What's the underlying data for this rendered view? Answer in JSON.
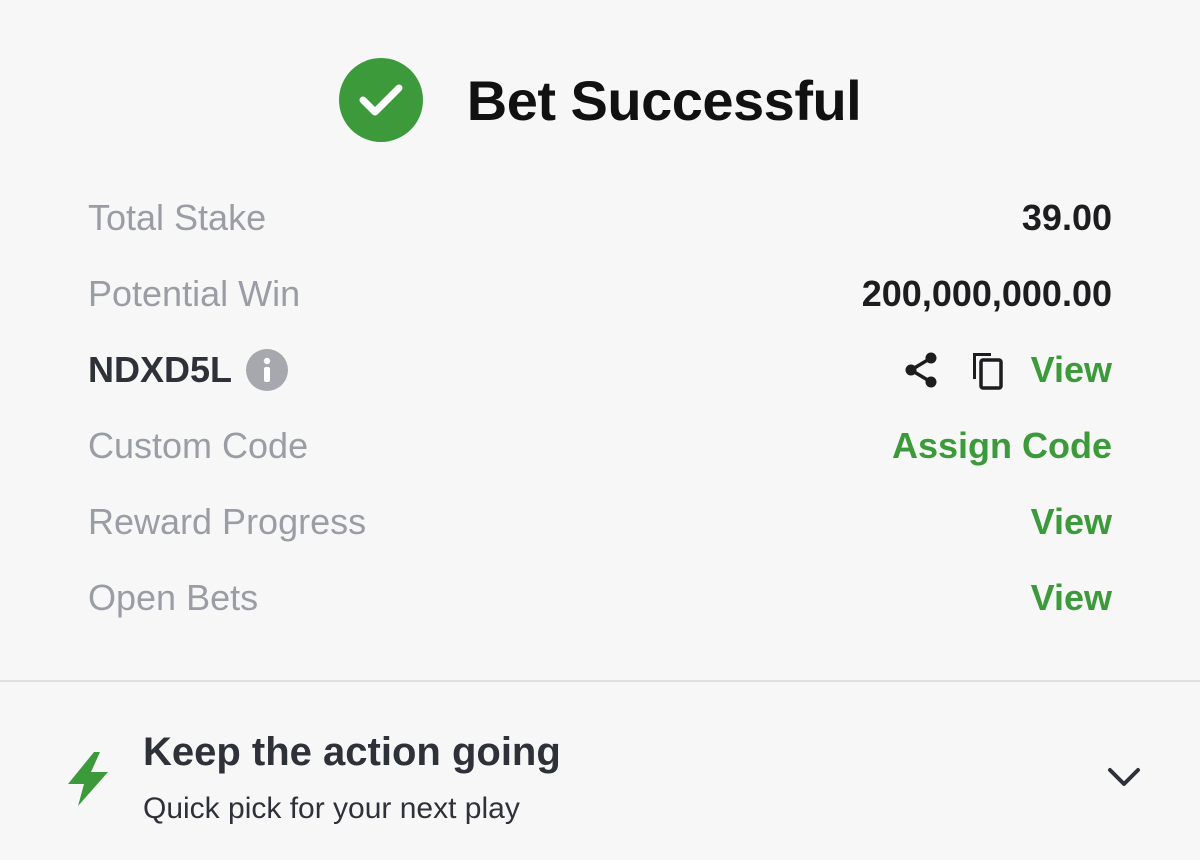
{
  "header": {
    "title": "Bet Successful",
    "icon": "check-circle-icon",
    "accent_color": "#3d9a3b"
  },
  "rows": [
    {
      "label": "Total Stake",
      "value": "39.00"
    },
    {
      "label": "Potential Win",
      "value": "200,000,000.00"
    },
    {
      "label": "NDXD5L",
      "info_icon": "info-icon",
      "actions": [
        "share-icon",
        "copy-icon"
      ],
      "link": "View"
    },
    {
      "label": "Custom Code",
      "link": "Assign Code"
    },
    {
      "label": "Reward Progress",
      "link": "View"
    },
    {
      "label": "Open Bets",
      "link": "View"
    }
  ],
  "promo": {
    "icon": "lightning-bolt-icon",
    "title": "Keep the action going",
    "subtitle": "Quick pick for your next play",
    "expand_icon": "chevron-down-icon"
  }
}
